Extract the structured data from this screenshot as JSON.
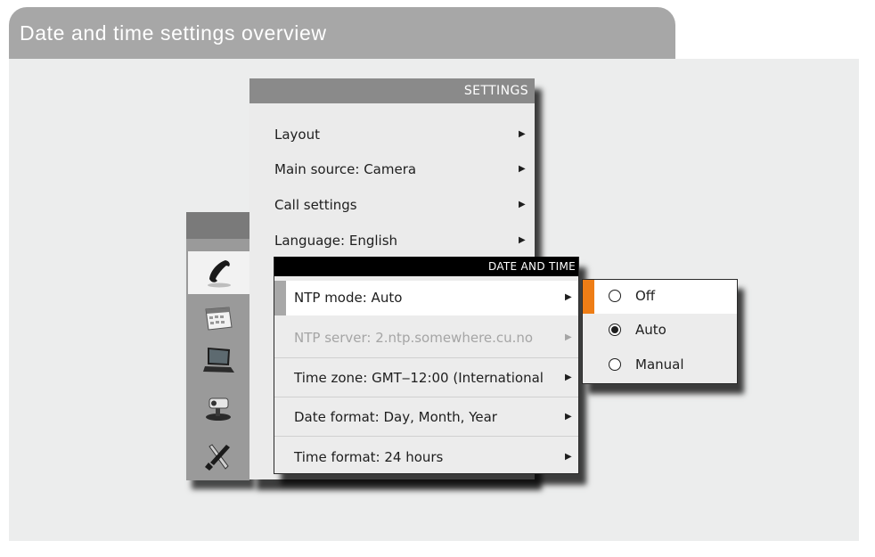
{
  "page": {
    "title": "Date and time settings overview",
    "accent_color": "#ee7d16"
  },
  "iconbar": {
    "items": [
      {
        "icon": "phone-handset-icon",
        "active": true
      },
      {
        "icon": "calendar-icon",
        "active": false
      },
      {
        "icon": "laptop-icon",
        "active": false
      },
      {
        "icon": "video-camera-icon",
        "active": false
      },
      {
        "icon": "tools-icon",
        "active": false
      }
    ]
  },
  "settings_menu": {
    "title": "SETTINGS",
    "items": [
      {
        "label": "Layout"
      },
      {
        "label": "Main source: Camera"
      },
      {
        "label": "Call settings"
      },
      {
        "label": "Language: English"
      }
    ]
  },
  "date_time_menu": {
    "title": "DATE AND TIME",
    "items": [
      {
        "label": "NTP mode: Auto",
        "state": "selected"
      },
      {
        "label": "NTP server: 2.ntp.somewhere.cu.no",
        "state": "disabled"
      },
      {
        "label": "Time zone: GMT‒12:00 (International",
        "state": "normal"
      },
      {
        "label": "Date format: Day, Month, Year",
        "state": "normal"
      },
      {
        "label": "Time format: 24 hours",
        "state": "normal"
      }
    ]
  },
  "ntp_mode_options": {
    "items": [
      {
        "label": "Off",
        "highlighted": true,
        "checked": false
      },
      {
        "label": "Auto",
        "highlighted": false,
        "checked": true
      },
      {
        "label": "Manual",
        "highlighted": false,
        "checked": false
      }
    ]
  },
  "glyphs": {
    "arrow": "▶"
  }
}
